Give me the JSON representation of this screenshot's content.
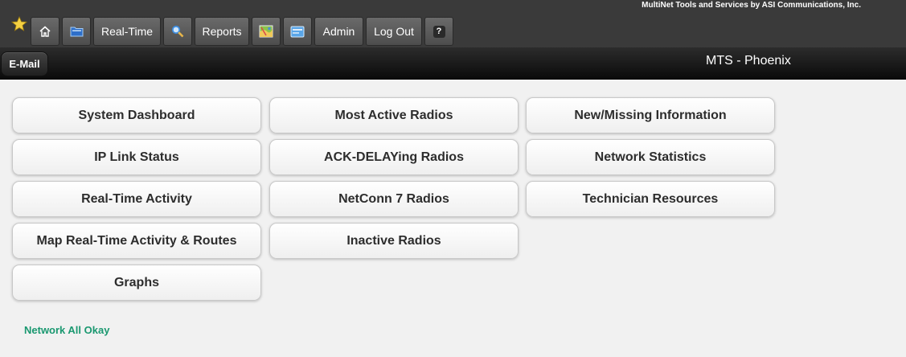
{
  "header": {
    "company": "MultiNet Tools and Services by ASI Communications, Inc.",
    "site_title": "MTS - Phoenix",
    "email_label": "E-Mail"
  },
  "nav": {
    "realtime_label": "Real-Time",
    "reports_label": "Reports",
    "admin_label": "Admin",
    "logout_label": "Log Out",
    "help_label": "?"
  },
  "menu": {
    "col1": [
      "System Dashboard",
      "IP Link Status",
      "Real-Time Activity",
      "Map Real-Time Activity & Routes",
      "Graphs"
    ],
    "col2": [
      "Most Active Radios",
      "ACK-DELAYing Radios",
      "NetConn 7 Radios",
      "Inactive Radios"
    ],
    "col3": [
      "New/Missing Information",
      "Network Statistics",
      "Technician Resources"
    ]
  },
  "status": {
    "text": "Network All Okay",
    "color": "#1a9870"
  },
  "icons": [
    "star-icon",
    "home-icon",
    "folder-icon",
    "search-icon",
    "map-icon",
    "screen-icon",
    "help-icon"
  ]
}
